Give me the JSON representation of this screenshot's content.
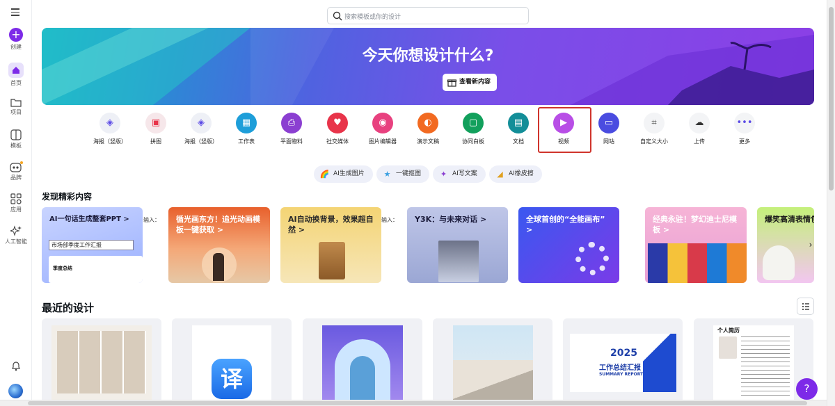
{
  "sidebar": {
    "items": [
      {
        "label": "创建",
        "icon": "plus-icon"
      },
      {
        "label": "首页",
        "icon": "home-icon"
      },
      {
        "label": "项目",
        "icon": "folder-icon"
      },
      {
        "label": "模板",
        "icon": "template-icon"
      },
      {
        "label": "品牌",
        "icon": "brand-icon"
      },
      {
        "label": "应用",
        "icon": "apps-icon"
      },
      {
        "label": "人工智能",
        "icon": "sparkle-icon"
      }
    ]
  },
  "search": {
    "placeholder": "搜索模板或你的设计"
  },
  "hero": {
    "title": "今天你想设计什么?",
    "button": "查看新内容"
  },
  "categories": [
    {
      "label": "海报（竖版）",
      "color": "#eef0f6"
    },
    {
      "label": "拼图",
      "color": "#f3e8ea"
    },
    {
      "label": "海报（竖版）",
      "color": "#eef0f6"
    },
    {
      "label": "工作表",
      "color": "#1e9ed9"
    },
    {
      "label": "平面物料",
      "color": "#8b3fd1"
    },
    {
      "label": "社交媒体",
      "color": "#e8344a"
    },
    {
      "label": "图片编辑器",
      "color": "#e8417f"
    },
    {
      "label": "演示文稿",
      "color": "#f26a21"
    },
    {
      "label": "协同白板",
      "color": "#12a05c"
    },
    {
      "label": "文档",
      "color": "#138e98"
    },
    {
      "label": "视频",
      "color": "#b84ee6"
    },
    {
      "label": "网站",
      "color": "#4a4ce0"
    },
    {
      "label": "自定义大小",
      "color": "#f3f4f6"
    },
    {
      "label": "上传",
      "color": "#f3f4f6"
    },
    {
      "label": "更多",
      "color": "#f3f4f6"
    }
  ],
  "ai_chips": [
    "AI生成图片",
    "一键抠图",
    "AI写文案",
    "AI橡皮擦"
  ],
  "discover": {
    "title": "发现精彩内容",
    "cards": [
      {
        "title": "AI一句话生成整套PPT >",
        "input_text": "市场部季度工作汇报",
        "sub": "季度总结"
      },
      {
        "title": "循光画东方！追光动画模板一键获取 >"
      },
      {
        "title": "AI自动换背景，效果超自然 >"
      },
      {
        "title": "Y3K：与未来对话 >"
      },
      {
        "title": "全球首创的“全能画布” >"
      },
      {
        "title": "经典永驻！梦幻迪士尼模板 >"
      },
      {
        "title": "爆笑高清表情包"
      }
    ],
    "gap_text": "输入："
  },
  "recent": {
    "title": "最近的设计",
    "items": [
      {
        "name": "photo-collage"
      },
      {
        "name": "translate-app",
        "text": "译"
      },
      {
        "name": "portrait-poster"
      },
      {
        "name": "architecture-photo"
      },
      {
        "name": "report-2025",
        "text": "2025",
        "sub": "工作总结汇报",
        "en": "SUMMARY REPORT"
      },
      {
        "name": "resume",
        "text": "个人简历"
      }
    ]
  },
  "help": {
    "label": "?"
  }
}
